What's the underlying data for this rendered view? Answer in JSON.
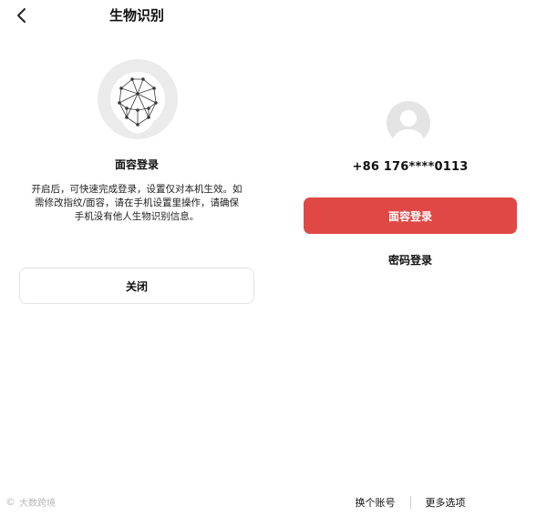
{
  "left": {
    "nav_title": "生物识别",
    "section_title": "面容登录",
    "description_lines": [
      "开启后，可快速完成登录，设置仅对本机生效。如",
      "需修改指纹/面容，请在手机设置里操作，请确保",
      "手机没有他人生物识别信息。"
    ],
    "close_label": "关闭",
    "watermark": "大数跨境"
  },
  "right": {
    "phone": "+86 176****0113",
    "face_login_label": "面容登录",
    "password_login_label": "密码登录",
    "switch_account_label": "换个账号",
    "more_options_label": "更多选项"
  },
  "colors": {
    "primary": "#e04845",
    "art_gray": "#ebebeb",
    "art_dark": "#3a3a3a"
  },
  "icons": [
    "back-arrow-icon",
    "face-recognition-icon",
    "avatar-icon"
  ]
}
